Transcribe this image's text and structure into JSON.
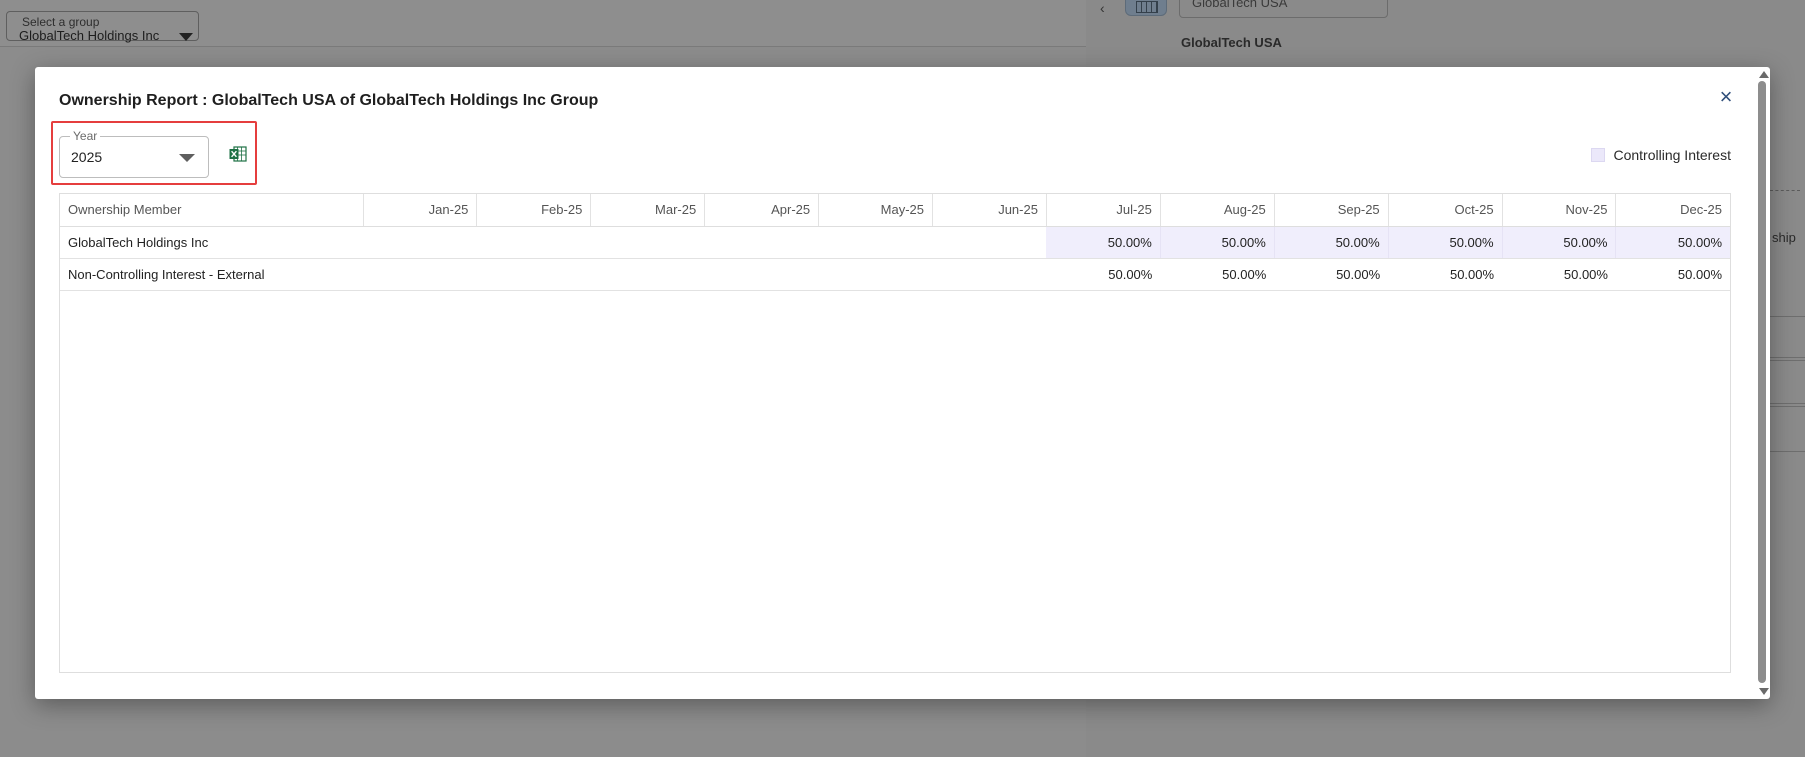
{
  "background": {
    "group_select": {
      "label": "Select a group",
      "value": "GlobalTech Holdings Inc"
    },
    "side_panel": {
      "input_value": "GlobalTech USA",
      "entity_name": "GlobalTech USA",
      "truncated_text": "ship"
    }
  },
  "modal": {
    "title": "Ownership Report : GlobalTech USA of GlobalTech Holdings Inc Group",
    "close_label": "×",
    "year_field": {
      "label": "Year",
      "value": "2025"
    },
    "export_icon": "excel-icon",
    "legend": {
      "label": "Controlling Interest",
      "color": "#ebe8fa"
    },
    "table": {
      "columns": [
        "Ownership Member",
        "Jan-25",
        "Feb-25",
        "Mar-25",
        "Apr-25",
        "May-25",
        "Jun-25",
        "Jul-25",
        "Aug-25",
        "Sep-25",
        "Oct-25",
        "Nov-25",
        "Dec-25"
      ],
      "rows": [
        {
          "member": "GlobalTech Holdings Inc",
          "controlling": true,
          "values": [
            "",
            "",
            "",
            "",
            "",
            "",
            "50.00%",
            "50.00%",
            "50.00%",
            "50.00%",
            "50.00%",
            "50.00%"
          ]
        },
        {
          "member": "Non-Controlling Interest - External",
          "controlling": false,
          "values": [
            "",
            "",
            "",
            "",
            "",
            "",
            "50.00%",
            "50.00%",
            "50.00%",
            "50.00%",
            "50.00%",
            "50.00%"
          ]
        }
      ]
    }
  },
  "colors": {
    "highlight_border": "#e53e3e",
    "controlling_fill": "#f0eefc",
    "close_icon": "#2f4e7a"
  }
}
